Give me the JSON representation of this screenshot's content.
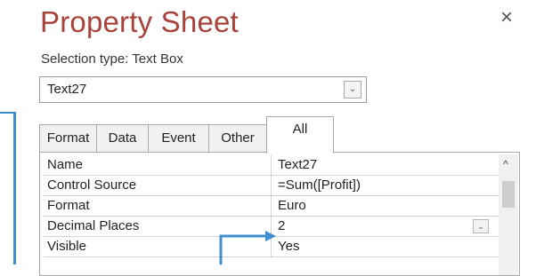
{
  "header": {
    "title": "Property Sheet",
    "close_icon_glyph": "×",
    "selection_type": "Selection type:  Text Box"
  },
  "selector": {
    "value": "Text27",
    "dropdown_glyph": "⌄"
  },
  "tabs": [
    {
      "label": "Format",
      "active": false
    },
    {
      "label": "Data",
      "active": false
    },
    {
      "label": "Event",
      "active": false
    },
    {
      "label": "Other",
      "active": false
    },
    {
      "label": "All",
      "active": true
    }
  ],
  "properties": [
    {
      "name": "Name",
      "value": "Text27"
    },
    {
      "name": "Control Source",
      "value": "=Sum([Profit])"
    },
    {
      "name": "Format",
      "value": "Euro"
    },
    {
      "name": "Decimal Places",
      "value": "2",
      "has_dropdown": true
    },
    {
      "name": "Visible",
      "value": "Yes"
    }
  ],
  "scroll": {
    "up_glyph": "^"
  },
  "colors": {
    "title": "#a9423a",
    "annotation": "#3d8fd0"
  },
  "icons": [
    "close-icon",
    "chevron-down-icon",
    "scroll-up-icon",
    "annotation-arrow"
  ]
}
